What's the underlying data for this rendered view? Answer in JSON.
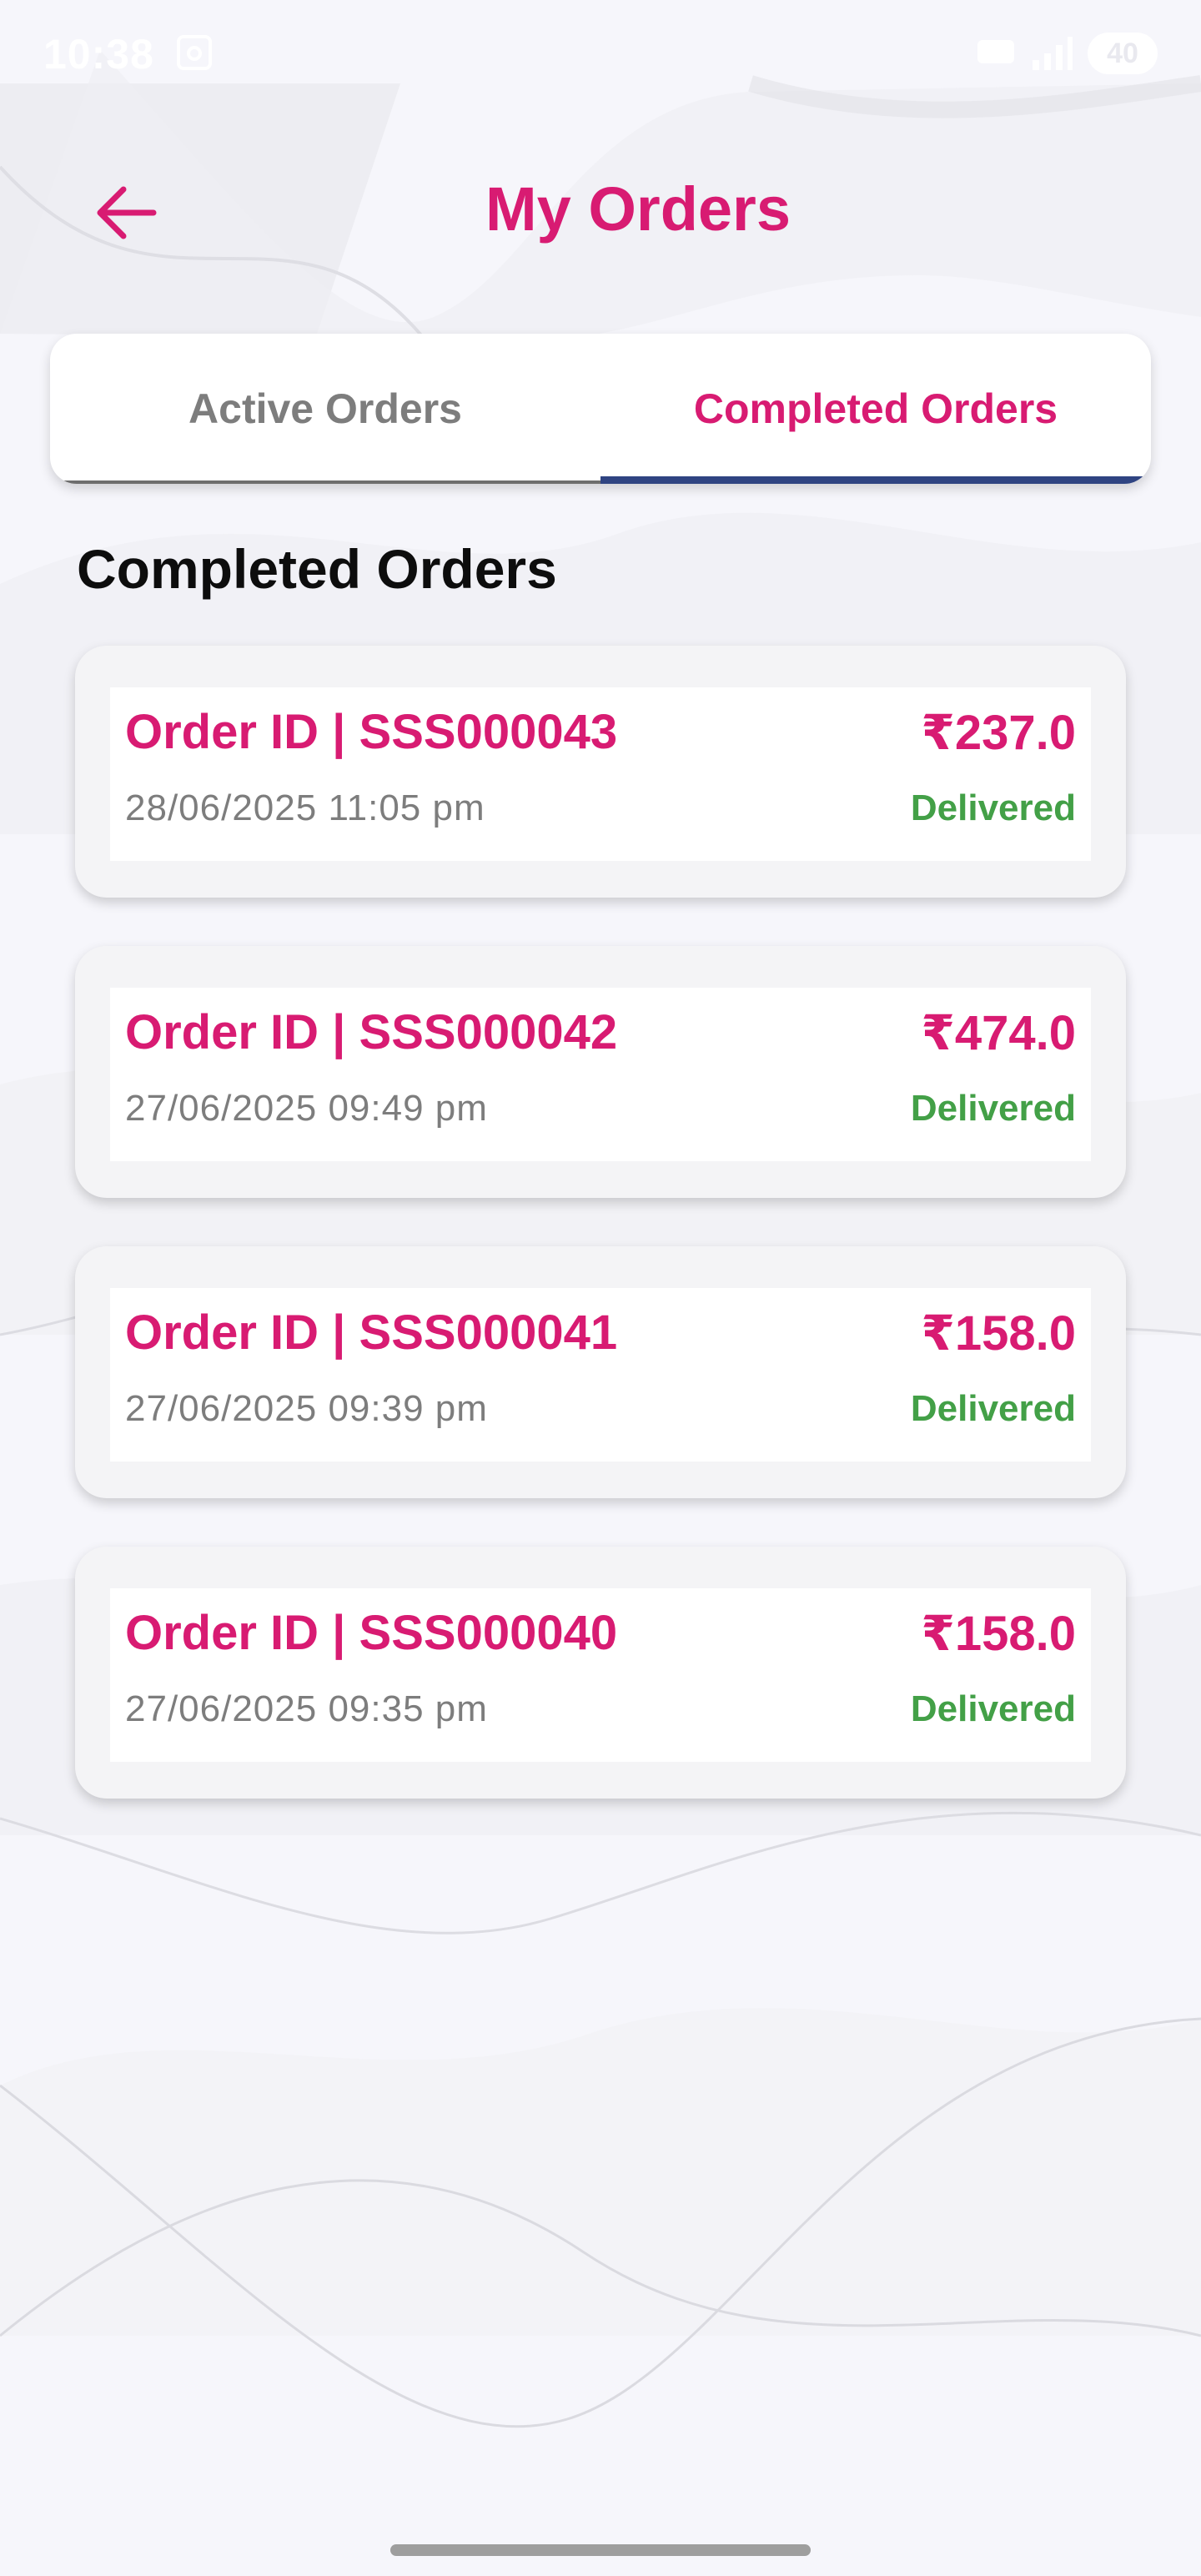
{
  "status_bar": {
    "time": "10:38",
    "battery": "40"
  },
  "header": {
    "title": "My Orders"
  },
  "tabs": [
    {
      "label": "Active Orders",
      "selected": false
    },
    {
      "label": "Completed Orders",
      "selected": true
    }
  ],
  "section": {
    "heading": "Completed Orders"
  },
  "orders": [
    {
      "id": "Order ID | SSS000043",
      "amount": "₹237.0",
      "date": "28/06/2025 11:05 pm",
      "status": "Delivered"
    },
    {
      "id": "Order ID | SSS000042",
      "amount": "₹474.0",
      "date": "27/06/2025 09:49 pm",
      "status": "Delivered"
    },
    {
      "id": "Order ID | SSS000041",
      "amount": "₹158.0",
      "date": "27/06/2025 09:39 pm",
      "status": "Delivered"
    },
    {
      "id": "Order ID | SSS000040",
      "amount": "₹158.0",
      "date": "27/06/2025 09:35 pm",
      "status": "Delivered"
    }
  ],
  "colors": {
    "brand_pink": "#d81b72",
    "status_green": "#43a047",
    "tab_indicator": "#2f4482",
    "background": "#f6f6fb"
  },
  "icons": {
    "back": "arrow-left-icon",
    "status_left": "screenshot-icon",
    "signal": "signal-icon",
    "volte": "volte-icon"
  }
}
